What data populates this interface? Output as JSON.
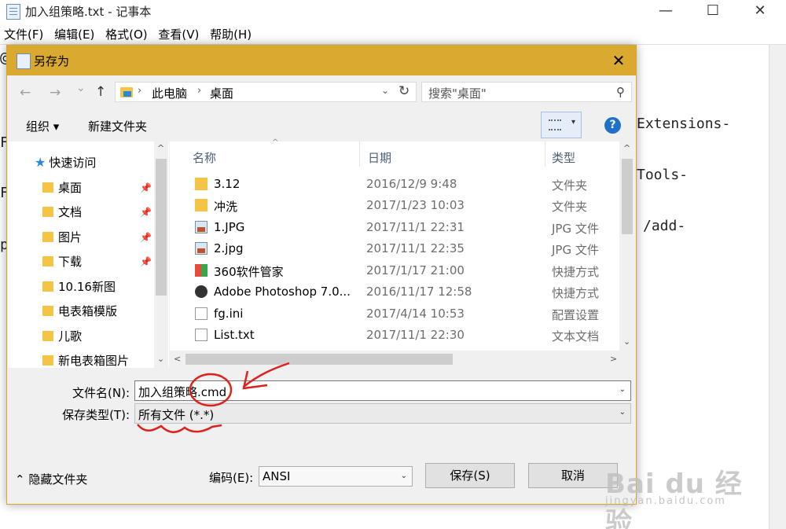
{
  "notepad": {
    "title": "加入组策略.txt - 记事本",
    "controls": {
      "minimize": "—",
      "maximize": "☐",
      "close": "✕"
    },
    "menu": [
      "文件(F)",
      "编辑(E)",
      "格式(O)",
      "查看(V)",
      "帮助(H)"
    ],
    "fragments": {
      "f1": "@",
      "f2": "F",
      "f3": "F",
      "f4": "p",
      "f5": "Extensions-",
      "f6": "Tools-",
      "f7": "/add-"
    }
  },
  "dialog": {
    "title": "另存为",
    "close": "✕",
    "nav": {
      "back": "←",
      "forward": "→",
      "recent": "⌄",
      "up": "↑"
    },
    "address": {
      "crumbs": [
        "此电脑",
        "桌面"
      ],
      "sep": "›"
    },
    "search_placeholder": "搜索\"桌面\"",
    "toolbar": {
      "organize": "组织 ▾",
      "new_folder": "新建文件夹",
      "help": "?"
    },
    "nav_pane": {
      "quick_access": "快速访问",
      "items": [
        "桌面",
        "文档",
        "图片",
        "下载",
        "10.16新图",
        "电表箱模版",
        "儿歌",
        "新电表箱图片"
      ]
    },
    "columns": {
      "name": "名称",
      "date": "日期",
      "type": "类型"
    },
    "files": [
      {
        "name": "3.12",
        "date": "2016/12/9 9:48",
        "type": "文件夹",
        "icon": "folder"
      },
      {
        "name": "冲洗",
        "date": "2017/1/23 10:03",
        "type": "文件夹",
        "icon": "folder"
      },
      {
        "name": "1.JPG",
        "date": "2017/11/1 22:31",
        "type": "JPG 文件",
        "icon": "img"
      },
      {
        "name": "2.jpg",
        "date": "2017/11/1 22:35",
        "type": "JPG 文件",
        "icon": "img"
      },
      {
        "name": "360软件管家",
        "date": "2017/1/17 21:00",
        "type": "快捷方式",
        "icon": "360"
      },
      {
        "name": "Adobe Photoshop 7.0...",
        "date": "2016/11/17 12:58",
        "type": "快捷方式",
        "icon": "ps"
      },
      {
        "name": "fg.ini",
        "date": "2017/4/14 10:53",
        "type": "配置设置",
        "icon": "ini"
      },
      {
        "name": "List.txt",
        "date": "2017/11/1 22:30",
        "type": "文本文档",
        "icon": "txt"
      }
    ],
    "filename_label": "文件名(N):",
    "filename_value": "加入组策略.cmd",
    "savetype_label": "保存类型(T):",
    "savetype_value": "所有文件  (*.*)",
    "hide_folders": "隐藏文件夹",
    "encoding_label": "编码(E):",
    "encoding_value": "ANSI",
    "save_button": "保存(S)",
    "cancel_button": "取消"
  },
  "watermark": {
    "brand": "Bai du 经验",
    "url": "jingyan.baidu.com"
  }
}
